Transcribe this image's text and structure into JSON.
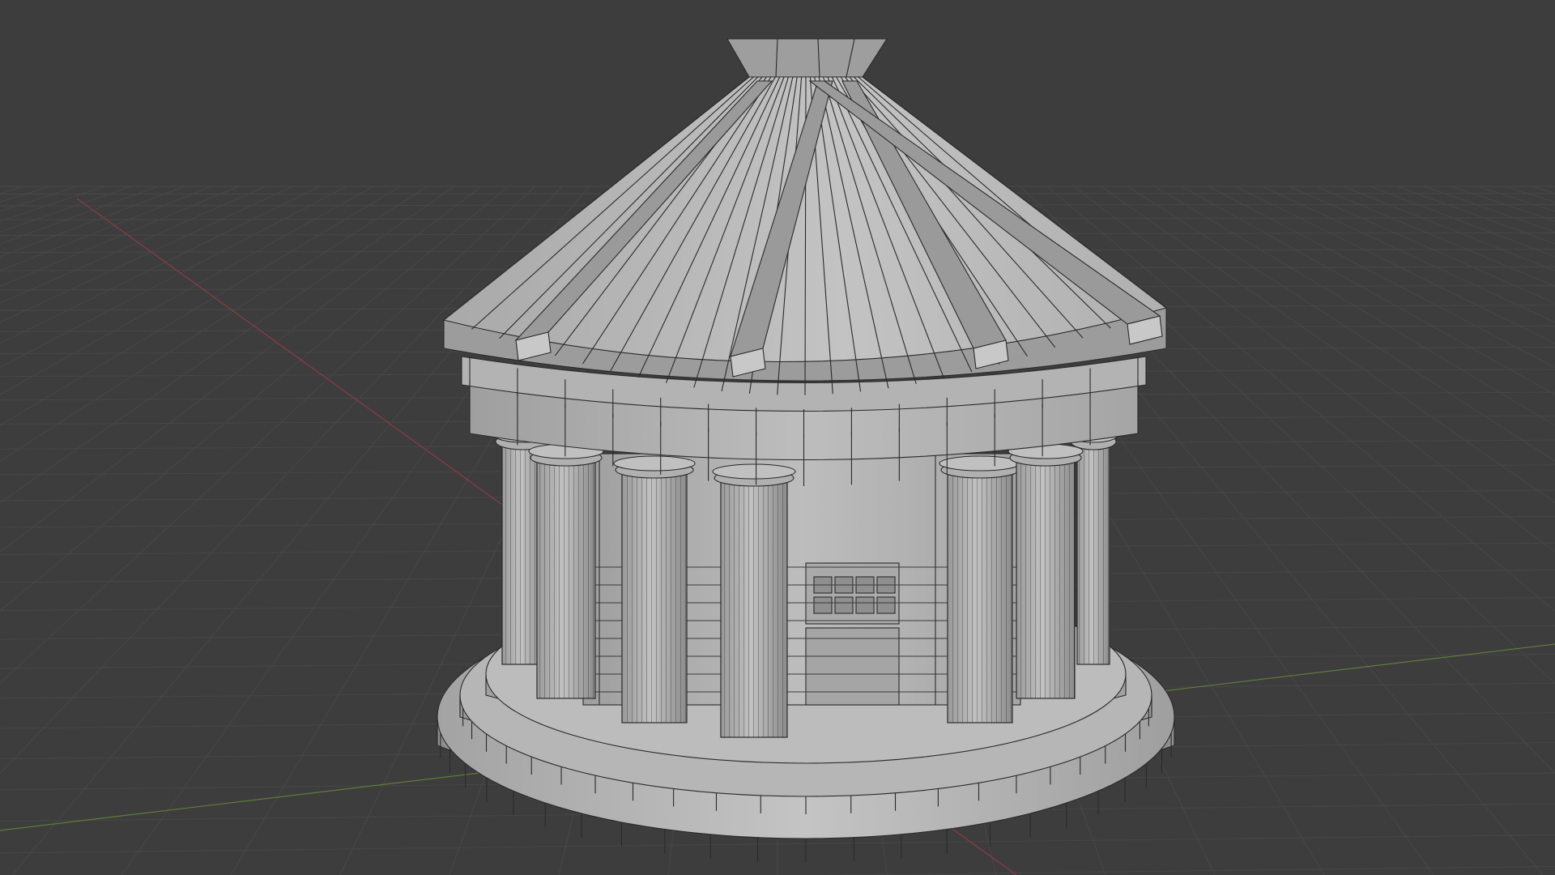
{
  "viewport": {
    "background_color": "#3d3d3d",
    "grid_color": "#484848",
    "x_axis_color": "#8f3a45",
    "y_axis_color": "#5f7d3a"
  },
  "model": {
    "name": "temple",
    "column_count": 8,
    "wire_color": "#2a2a2a",
    "light_face": "#b9b9b9",
    "mid_face": "#a6a6a6",
    "shadow_face": "#8a8a8a"
  }
}
